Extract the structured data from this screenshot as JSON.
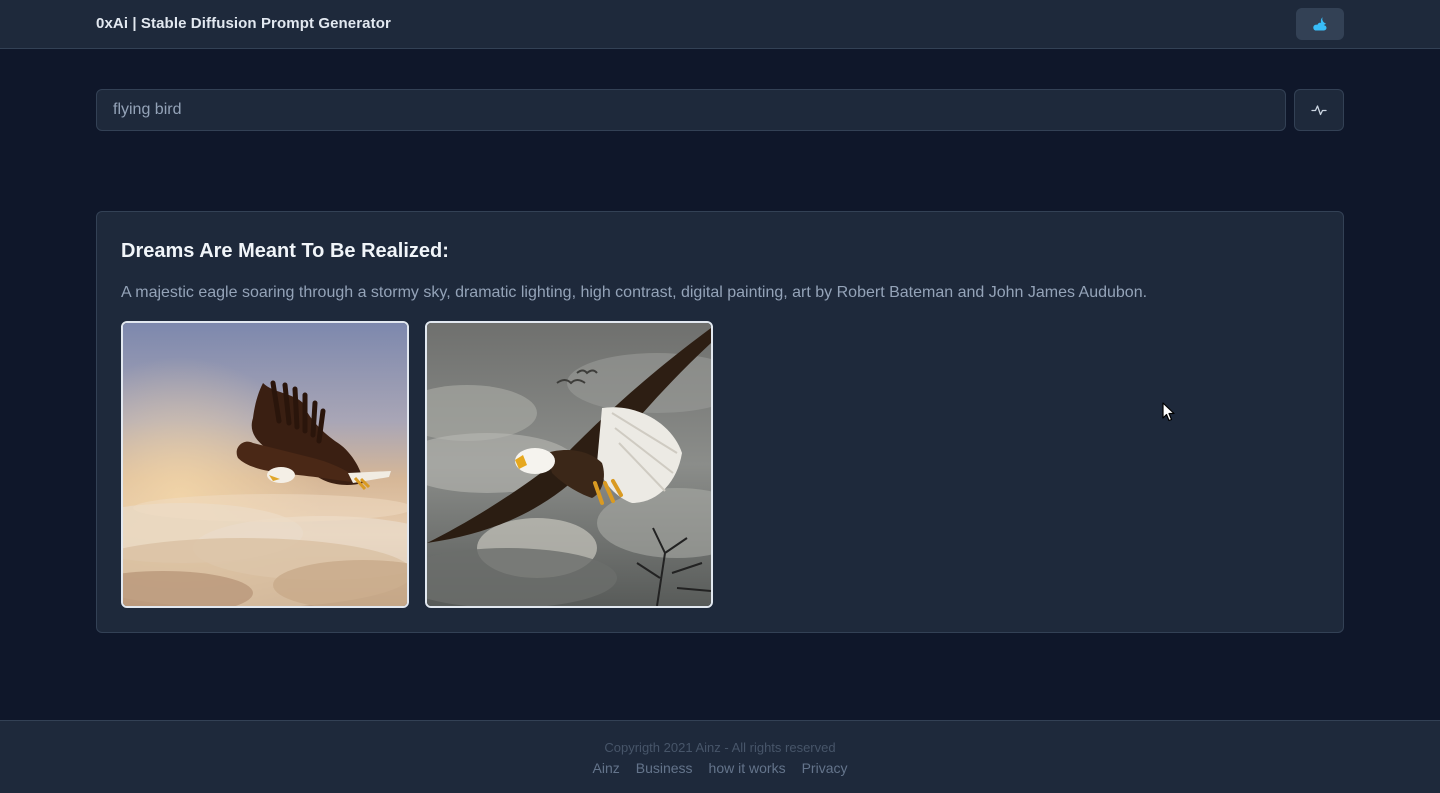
{
  "header": {
    "app_title": "0xAi | Stable Diffusion Prompt Generator",
    "theme_icon": "cloud-moon-icon"
  },
  "search": {
    "value": "flying bird",
    "placeholder": "",
    "submit_icon": "pulse-icon"
  },
  "result": {
    "heading": "Dreams Are Meant To Be Realized:",
    "prompt": "A majestic eagle soaring through a stormy sky, dramatic lighting, high contrast, digital painting, art by Robert Bateman and John James Audubon.",
    "images": [
      {
        "alt": "bald eagle flying above sunlit clouds"
      },
      {
        "alt": "bald eagle with spread wings in stormy grey sky"
      }
    ]
  },
  "footer": {
    "copyright": "Copyrigth 2021 Ainz - All rights reserved",
    "links": [
      "Ainz",
      "Business",
      "how it works",
      "Privacy"
    ]
  },
  "colors": {
    "page_bg": "#0f172a",
    "surface": "#1e293b",
    "border": "#334155",
    "accent": "#38bdf8"
  }
}
